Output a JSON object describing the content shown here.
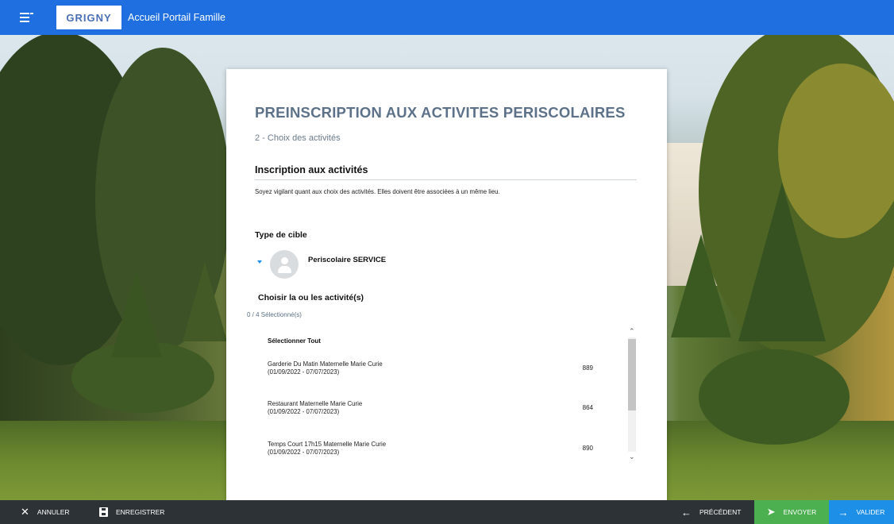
{
  "topbar": {
    "logo_text": "GRIGNY",
    "title": "Accueil Portail Famille"
  },
  "colors": {
    "topbar": "#1f6fe0",
    "heading": "#5d7289",
    "envoyer": "#4caf50",
    "valider": "#1e8fe6",
    "bottombar": "#2c3236"
  },
  "form": {
    "title": "PREINSCRIPTION AUX ACTIVITES PERISCOLAIRES",
    "step": "2 - Choix des activités",
    "section_title": "Inscription aux activités",
    "notice": "Soyez vigilant quant aux choix des activités. Elles doivent être associées à un même lieu.",
    "target_type_label": "Type de cible",
    "service_name": "Periscolaire SERVICE",
    "choose_label": "Choisir la ou les activité(s)",
    "selected_count": "0 / 4 Sélectionné(s)",
    "select_all": "Sélectionner Tout",
    "activities": [
      {
        "name": "Garderie Du Matin Maternelle Marie Curie",
        "dates": "(01/09/2022 - 07/07/2023)",
        "code": "889"
      },
      {
        "name": "Restaurant Maternelle Marie Curie",
        "dates": "(01/09/2022 - 07/07/2023)",
        "code": "864"
      },
      {
        "name": "Temps Court 17h15 Maternelle Marie Curie",
        "dates": "(01/09/2022 - 07/07/2023)",
        "code": "890"
      }
    ]
  },
  "icons": {
    "menu": "menu-icon",
    "annuler": "close-icon",
    "enregistrer": "save-icon",
    "precedent": "arrow-left-icon",
    "envoyer": "send-icon",
    "valider": "arrow-right-icon",
    "avatar": "person-icon",
    "expand": "chevron-down-icon"
  },
  "bottombar": {
    "annuler": "ANNULER",
    "enregistrer": "ENREGISTRER",
    "precedent": "PRÉCÉDENT",
    "envoyer": "ENVOYER",
    "valider": "VALIDER"
  }
}
